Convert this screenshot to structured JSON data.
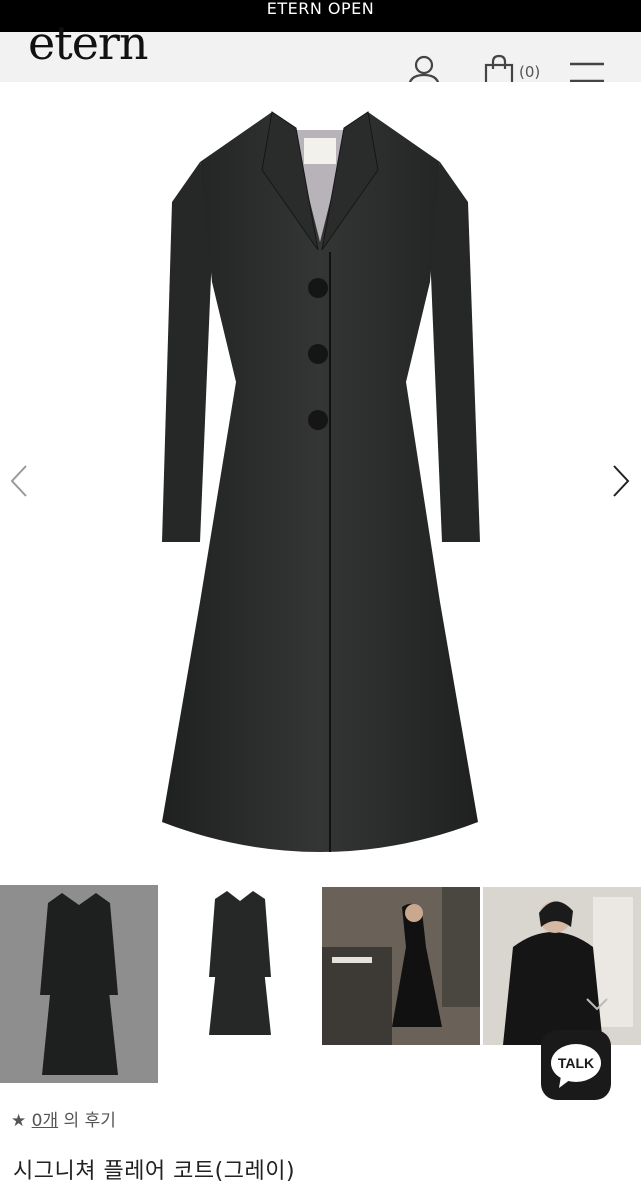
{
  "banner": {
    "text": "ETERN OPEN"
  },
  "header": {
    "logo": "etern",
    "cart_count": "(0)"
  },
  "product": {
    "review_star": "★",
    "review_count": "0개",
    "review_suffix": "의 후기",
    "title": "시그니쳐 플레어 코트(그레이)"
  },
  "talk_button": {
    "label": "TALK"
  },
  "colors": {
    "coat": "#2b2c2c",
    "banner_bg": "#000000",
    "header_bg": "#f2f2f2"
  }
}
